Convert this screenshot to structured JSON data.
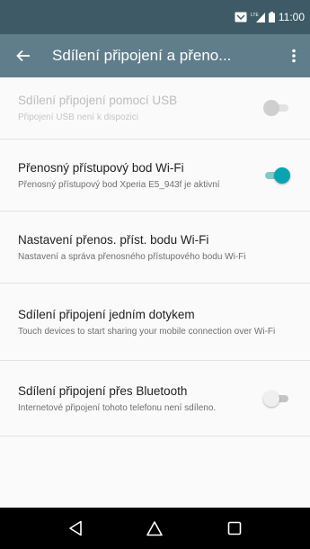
{
  "status_bar": {
    "time": "11:00",
    "network": "LTE"
  },
  "app_bar": {
    "title": "Sdílení připojení a přeno..."
  },
  "settings": [
    {
      "title": "Sdílení připojení pomocí USB",
      "summary": "Připojení USB není k dispozici",
      "toggle": "disabled"
    },
    {
      "title": "Přenosný přístupový bod Wi-Fi",
      "summary": "Přenosný přístupový bod Xperia E5_943f je aktivní",
      "toggle": "on"
    },
    {
      "title": "Nastavení přenos. příst. bodu Wi-Fi",
      "summary": "Nastavení a správa přenosného přístupového bodu Wi-Fi",
      "toggle": "none"
    },
    {
      "title": "Sdílení připojení jedním dotykem",
      "summary": "Touch devices to start sharing your mobile connection over Wi-Fi",
      "toggle": "none"
    },
    {
      "title": "Sdílení připojení přes Bluetooth",
      "summary": "Internetové připojení tohoto telefonu není sdíleno.",
      "toggle": "off"
    }
  ],
  "colors": {
    "app_bar": "#607d8b",
    "status_bar": "#3d5a66",
    "accent": "#0aa3b3"
  },
  "icons": {
    "back": "arrow-left-icon",
    "more": "more-vert-icon",
    "nav_back": "triangle-back-icon",
    "nav_home": "home-icon",
    "nav_recents": "square-recents-icon"
  }
}
